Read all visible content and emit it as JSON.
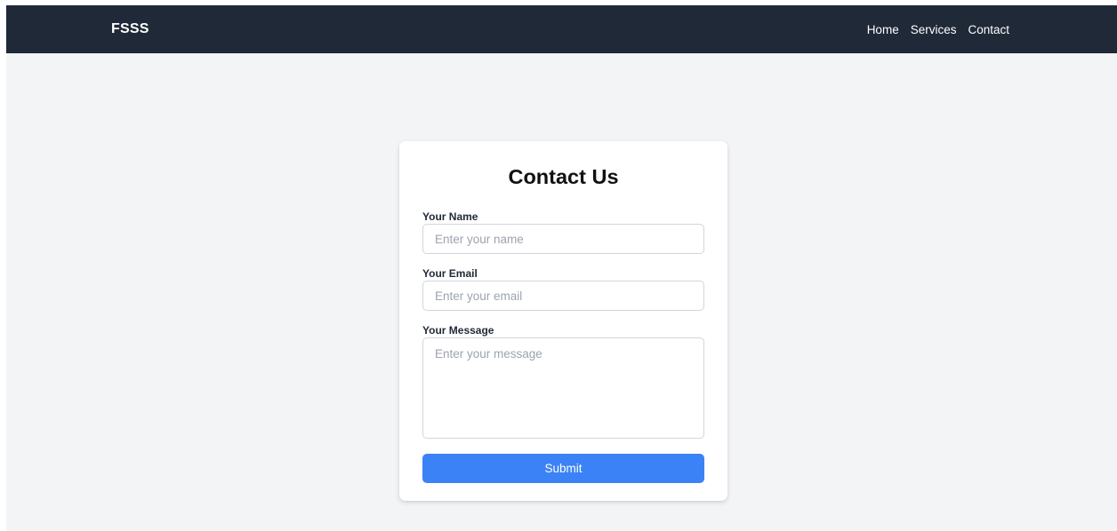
{
  "navbar": {
    "brand": "FSSS",
    "links": [
      "Home",
      "Services",
      "Contact"
    ]
  },
  "form": {
    "title": "Contact Us",
    "name": {
      "label": "Your Name",
      "placeholder": "Enter your name",
      "value": ""
    },
    "email": {
      "label": "Your Email",
      "placeholder": "Enter your email",
      "value": ""
    },
    "message": {
      "label": "Your Message",
      "placeholder": "Enter your message",
      "value": ""
    },
    "submit_label": "Submit"
  },
  "colors": {
    "navbar_bg": "#1f2937",
    "page_bg": "#f3f4f6",
    "card_bg": "#ffffff",
    "accent": "#3b82f6"
  }
}
